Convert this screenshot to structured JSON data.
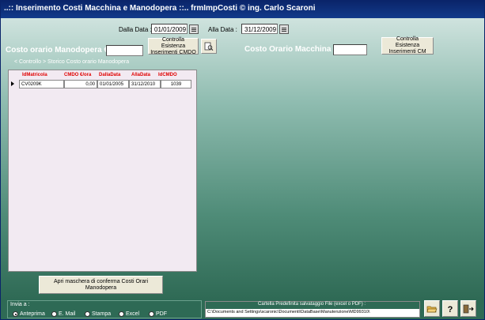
{
  "window": {
    "title": "..:: Inserimento Costi Macchina e Manodopera ::..   frmImpCosti © ing. Carlo Scaroni"
  },
  "dates": {
    "from_label": "Dalla Data :",
    "from_value": "01/01/2009",
    "to_label": "Alla Data :",
    "to_value": "31/12/2009"
  },
  "buttons": {
    "controlla_cmdo": "Controlla Esistenza Inserimenti CMDO",
    "controlla_cm": "Controlla Esistenza Inserimenti CM",
    "apri_maschera": "Apri maschera di conferma Costi Orari Manodopera"
  },
  "costs": {
    "manodopera_label": "Costo orario Manodopera € :",
    "manodopera_value": "",
    "macchina_label": "Costo Orario Macchina € :",
    "macchina_value": ""
  },
  "grid": {
    "caption": "< Controllo > Storico Costo orario Manodopera",
    "columns": [
      "IdMatricola",
      "CMDO €/ora",
      "DallaData",
      "AllaData",
      "IdCMDO"
    ],
    "rows": [
      [
        "CV0209K",
        "0,00",
        "01/01/2005",
        "31/12/2010",
        "1039"
      ]
    ]
  },
  "invia": {
    "label": "Invia a :",
    "options": [
      "Anteprima",
      "E. Mail",
      "Stampa",
      "Excel",
      "PDF"
    ],
    "selected": "Anteprima"
  },
  "folder": {
    "label": "Cartella Predefinita salvataggio File (excel o PDF) :",
    "path": "C:\\Documents and Settings\\scaronic\\Documenti\\DataBase\\Manutenzione\\MD99310\\"
  },
  "icons": {
    "open_folder": "folder-open-icon",
    "help": "help-icon",
    "exit": "exit-door-icon",
    "preview": "document-preview-icon",
    "calendar": "calendar-icon"
  },
  "colors": {
    "title_bar": "#0a246a",
    "accent_header": "#e00000",
    "background": "#3f7c68"
  }
}
